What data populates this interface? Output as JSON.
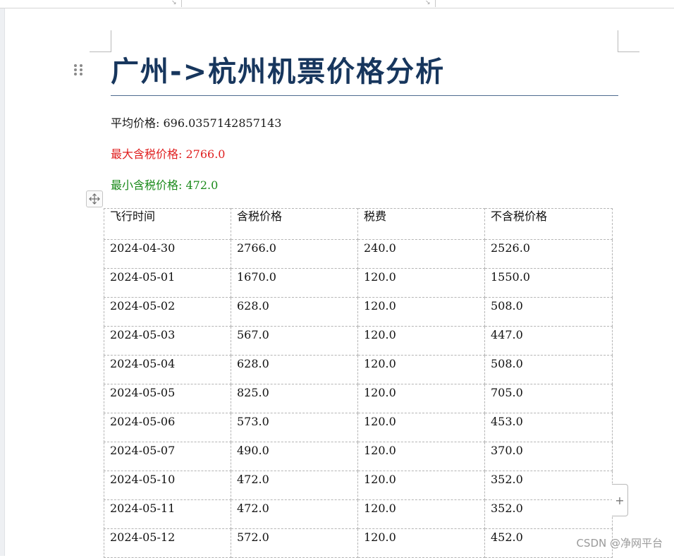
{
  "document": {
    "title": "广州->杭州机票价格分析"
  },
  "stats": {
    "average": "平均价格: 696.0357142857143",
    "max": "最大含税价格: 2766.0",
    "min": "最小含税价格: 472.0"
  },
  "colors": {
    "title": "#17365d",
    "max": "#e02020",
    "min": "#1a8a1a"
  },
  "table": {
    "headers": [
      "飞行时间",
      "含税价格",
      "税费",
      "不含税价格"
    ],
    "rows": [
      [
        "2024-04-30",
        "2766.0",
        "240.0",
        "2526.0"
      ],
      [
        "2024-05-01",
        "1670.0",
        "120.0",
        "1550.0"
      ],
      [
        "2024-05-02",
        "628.0",
        "120.0",
        "508.0"
      ],
      [
        "2024-05-03",
        "567.0",
        "120.0",
        "447.0"
      ],
      [
        "2024-05-04",
        "628.0",
        "120.0",
        "508.0"
      ],
      [
        "2024-05-05",
        "825.0",
        "120.0",
        "705.0"
      ],
      [
        "2024-05-06",
        "573.0",
        "120.0",
        "453.0"
      ],
      [
        "2024-05-07",
        "490.0",
        "120.0",
        "370.0"
      ],
      [
        "2024-05-10",
        "472.0",
        "120.0",
        "352.0"
      ],
      [
        "2024-05-11",
        "472.0",
        "120.0",
        "352.0"
      ],
      [
        "2024-05-12",
        "572.0",
        "120.0",
        "452.0"
      ]
    ]
  },
  "controls": {
    "add_row": "+"
  },
  "icons": {
    "drag_handle": "drag-handle-icon",
    "table_move": "move-icon"
  },
  "watermark": "CSDN @净网平台"
}
